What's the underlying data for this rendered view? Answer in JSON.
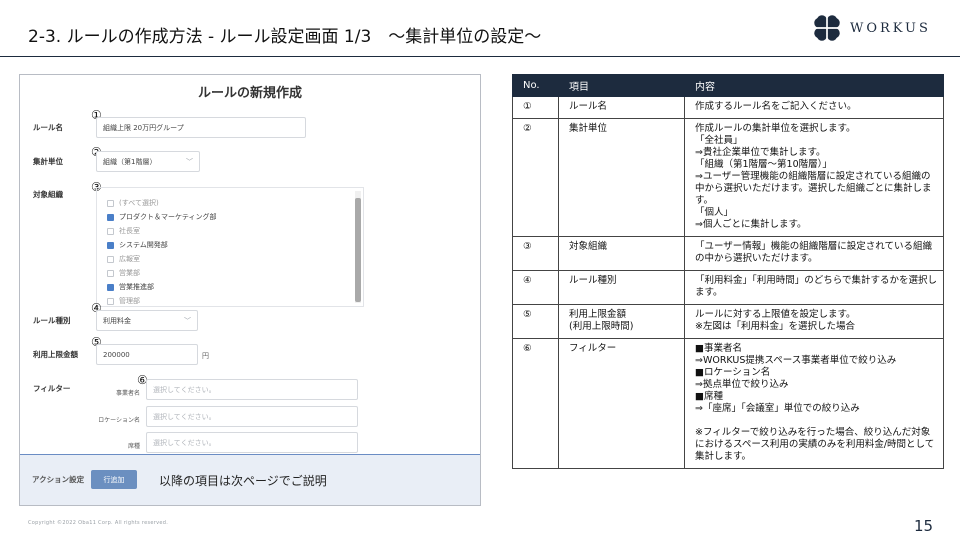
{
  "slide": {
    "title": "2-3. ルールの作成方法 - ルール設定画面 1/3　～集計単位の設定～",
    "logo_text": "WORKUS",
    "copyright": "Copyright ©2022 Oba11 Corp. All rights reserved.",
    "page_number": "15"
  },
  "form": {
    "title": "ルールの新規作成",
    "markers": [
      "①",
      "②",
      "③",
      "④",
      "⑤",
      "⑥"
    ],
    "rule_name": {
      "label": "ルール名",
      "value": "組織上限 20万円グループ"
    },
    "aggregation_unit": {
      "label": "集計単位",
      "value": "組織（第1階層）"
    },
    "target_org": {
      "label": "対象組織",
      "items": [
        {
          "label": "(すべて選択)",
          "checked": false
        },
        {
          "label": "プロダクト＆マーケティング部",
          "checked": true
        },
        {
          "label": "社長室",
          "checked": false
        },
        {
          "label": "システム開発部",
          "checked": true
        },
        {
          "label": "広報室",
          "checked": false
        },
        {
          "label": "営業部",
          "checked": false
        },
        {
          "label": "営業推進部",
          "checked": true
        },
        {
          "label": "管理部",
          "checked": false
        }
      ]
    },
    "rule_type": {
      "label": "ルール種別",
      "value": "利用料金"
    },
    "limit_amount": {
      "label": "利用上限金額",
      "value": "200000",
      "unit": "円"
    },
    "filter": {
      "label": "フィルター",
      "fields": [
        {
          "label": "事業者名",
          "placeholder": "選択してください。"
        },
        {
          "label": "ロケーション名",
          "placeholder": "選択してください。"
        },
        {
          "label": "席種",
          "placeholder": "選択してください。"
        }
      ]
    },
    "action": {
      "label": "アクション設定",
      "button": "行追加",
      "note": "以降の項目は次ページでご説明"
    }
  },
  "table": {
    "headers": [
      "No.",
      "項目",
      "内容"
    ],
    "rows": [
      {
        "no": "①",
        "item": [
          "ルール名"
        ],
        "content": [
          "作成するルール名をご記入ください。"
        ]
      },
      {
        "no": "②",
        "item": [
          "集計単位"
        ],
        "content": [
          "作成ルールの集計単位を選択します。",
          "「全社員」",
          "⇒貴社企業単位で集計します。",
          "「組織（第1階層～第10階層）」",
          "⇒ユーザー管理機能の組織階層に設定されている組織の中から選択いただけます。選択した組織ごとに集計します。",
          "「個人」",
          "⇒個人ごとに集計します。"
        ]
      },
      {
        "no": "③",
        "item": [
          "対象組織"
        ],
        "content": [
          "「ユーザー情報」機能の組織階層に設定されている組織の中から選択いただけます。"
        ]
      },
      {
        "no": "④",
        "item": [
          "ルール種別"
        ],
        "content": [
          "「利用料金」「利用時間」のどちらで集計するかを選択します。"
        ]
      },
      {
        "no": "⑤",
        "item": [
          "利用上限金額",
          "(利用上限時間)"
        ],
        "content": [
          "ルールに対する上限値を設定します。",
          "※左図は「利用料金」を選択した場合"
        ]
      },
      {
        "no": "⑥",
        "item": [
          "フィルター"
        ],
        "content": [
          "■事業者名",
          "⇒WORKUS提携スペース事業者単位で絞り込み",
          "■ロケーション名",
          "⇒拠点単位で絞り込み",
          "■席種",
          "⇒「座席」「会議室」単位での絞り込み",
          "",
          "※フィルターで絞り込みを行った場合、絞り込んだ対象におけるスペース利用の実績のみを利用料金/時間として集計します。"
        ]
      }
    ]
  },
  "colors": {
    "navy": "#1d2b3e",
    "accent_blue": "#4a7fc8",
    "button_blue": "#6b8fc0"
  },
  "icons": {
    "logo": "clover-logo-icon",
    "dropdown": "chevron-down-icon"
  }
}
